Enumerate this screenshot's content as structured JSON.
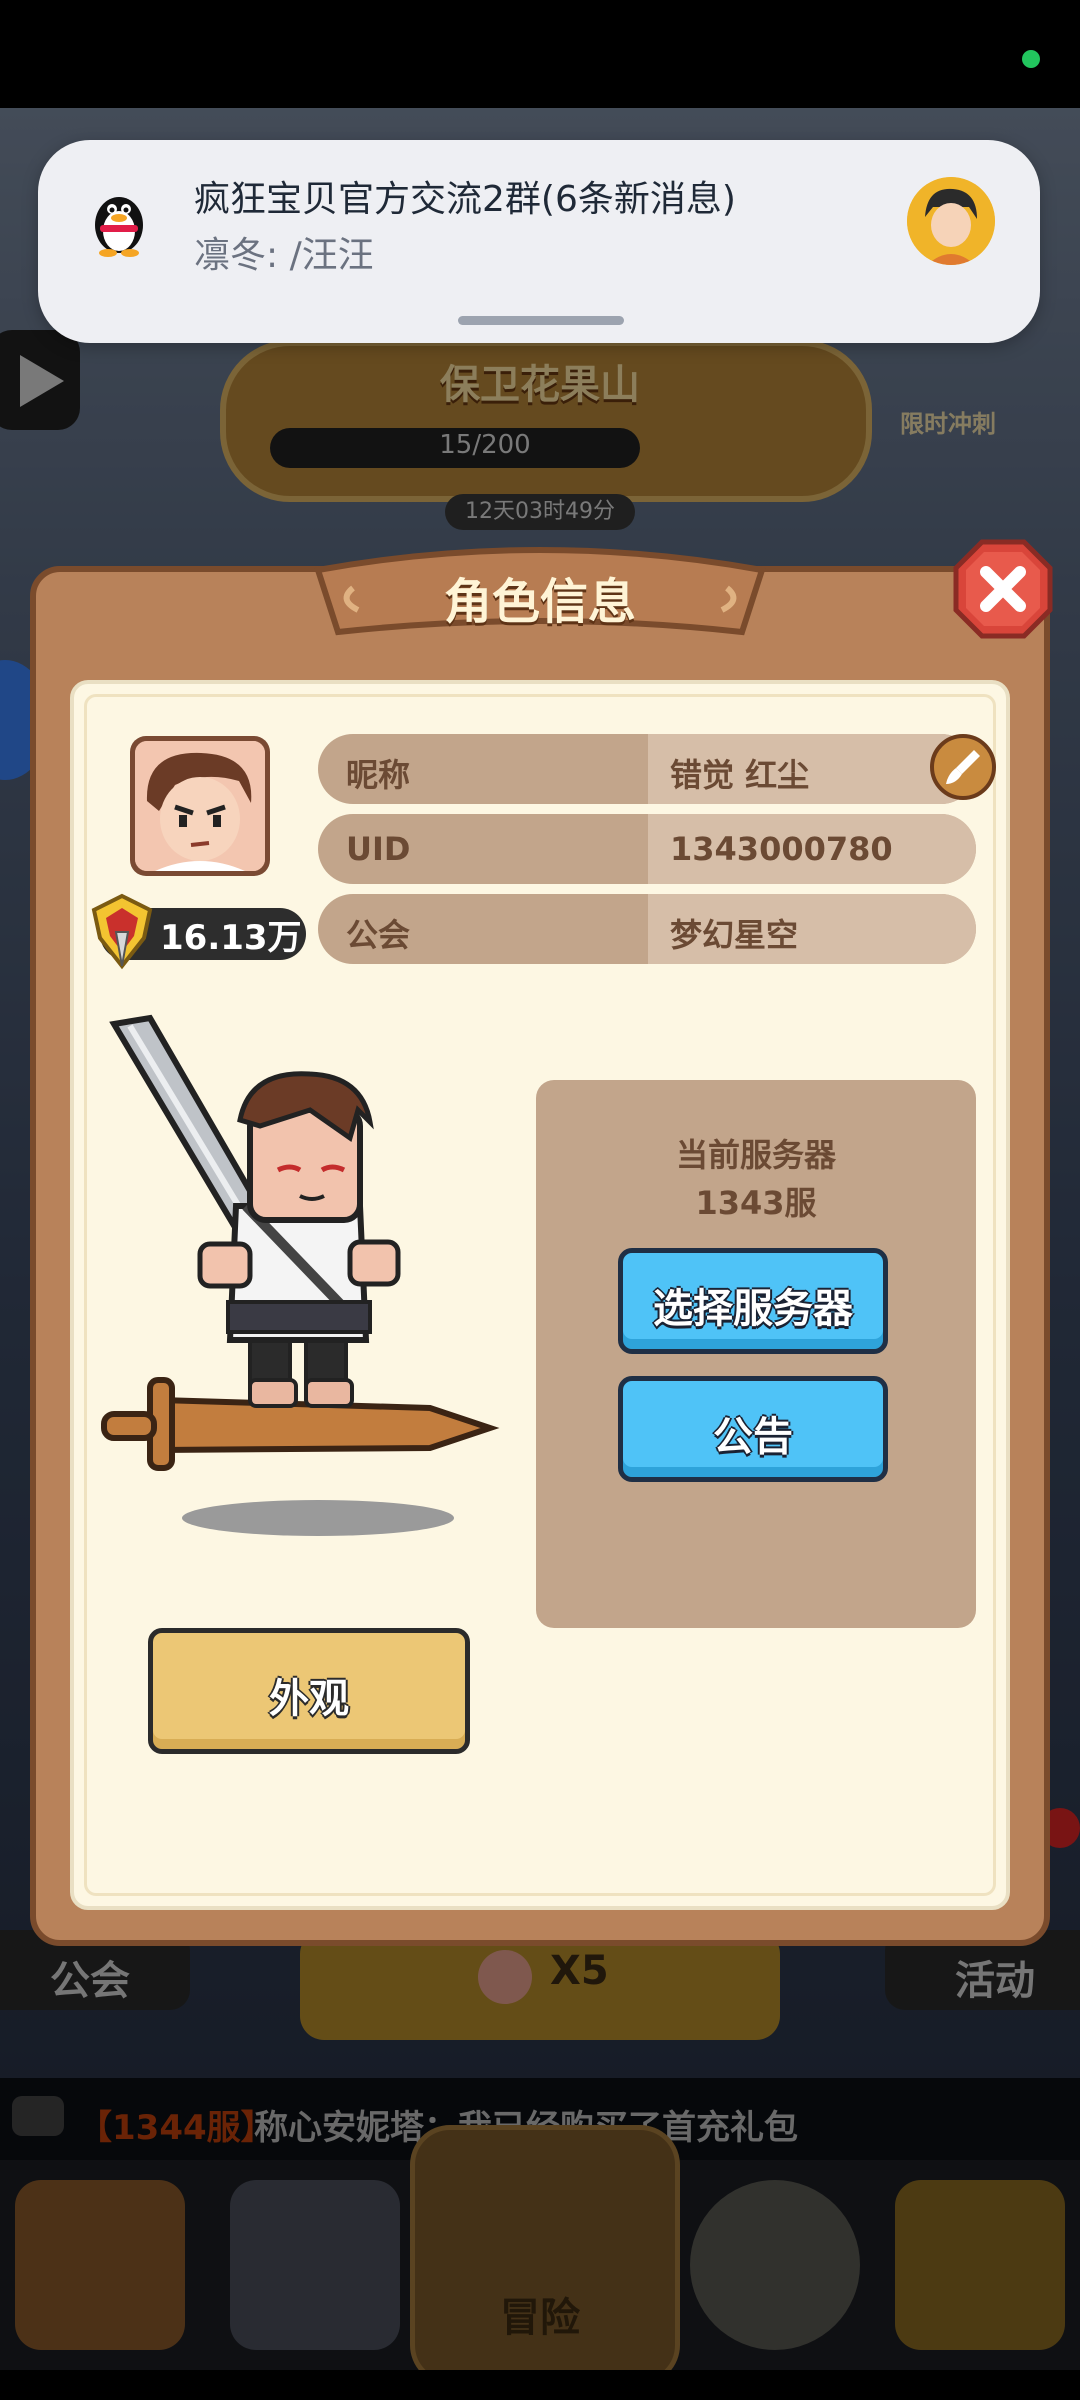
{
  "notification": {
    "title": "疯狂宝贝官方交流2群(6条新消息)",
    "body": "凛冬: /汪汪"
  },
  "event": {
    "title": "保卫花果山",
    "progress": "15/200",
    "timer": "12天03时49分",
    "limited_label": "限时冲刺"
  },
  "modal": {
    "title": "角色信息",
    "power": "16.13万",
    "rows": [
      {
        "label": "昵称",
        "value": "错觉  红尘"
      },
      {
        "label": "UID",
        "value": "1343000780"
      },
      {
        "label": "公会",
        "value": "梦幻星空"
      }
    ],
    "server_label": "当前服务器",
    "server_value": "1343服",
    "select_server_label": "选择服务器",
    "announcement_label": "公告",
    "appearance_label": "外观"
  },
  "background_ui": {
    "guild_tab": "公会",
    "center_tab": "X5",
    "activity_tab": "活动",
    "adventure_tab": "冒险"
  },
  "chat": {
    "server": "【1344服】",
    "message": "称心安妮塔：我已经购买了首充礼包"
  },
  "icons": {
    "qq": "qq-penguin-icon",
    "close": "close-x-icon",
    "edit": "brush-edit-icon",
    "power": "power-helmet-icon"
  },
  "colors": {
    "modal_frame": "#b8825a",
    "panel_bg": "#fdf7e3",
    "button_blue": "#4fc3f7",
    "button_gold": "#ecc775",
    "close_red": "#d9453a"
  }
}
